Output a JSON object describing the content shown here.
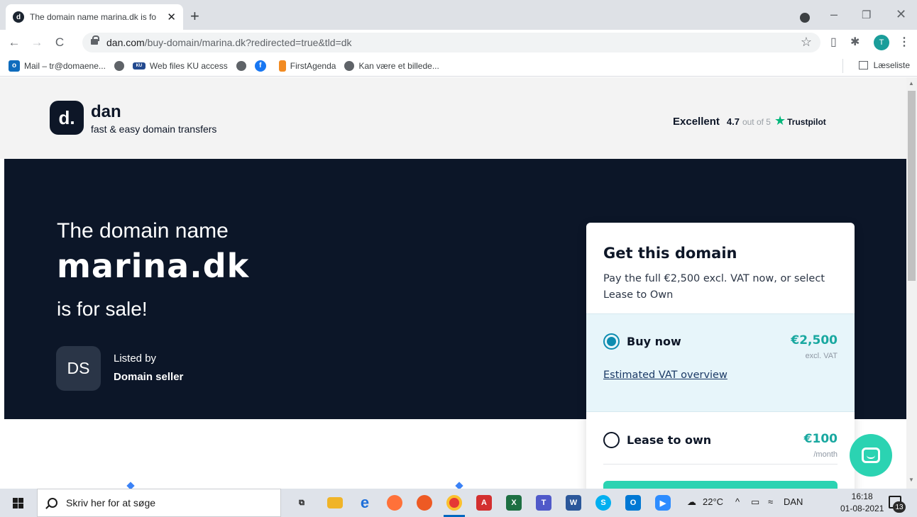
{
  "browser": {
    "tab_title": "The domain name marina.dk is fo",
    "url_host": "dan.com",
    "url_path": "/buy-domain/marina.dk?redirected=true&tld=dk",
    "new_tab": "+",
    "profile_initial": "T",
    "bookmarks": [
      {
        "label": "Mail – tr@domaene...",
        "icon": "outlook-icon"
      },
      {
        "label": "",
        "icon": "globe-icon"
      },
      {
        "label": "Web files KU access",
        "icon": "webfiles-icon"
      },
      {
        "label": "",
        "icon": "globe-icon"
      },
      {
        "label": "",
        "icon": "facebook-icon"
      },
      {
        "label": "FirstAgenda",
        "icon": "firstagenda-icon"
      },
      {
        "label": "Kan være et billede...",
        "icon": "globe-icon"
      }
    ],
    "reading_list": "Læseliste"
  },
  "header": {
    "brand": "dan",
    "tagline": "fast & easy domain transfers",
    "trust_word": "Excellent",
    "trust_rating": "4.7",
    "trust_outof": "out of 5",
    "trust_brand": "Trustpilot"
  },
  "hero": {
    "line1": "The domain name",
    "domain": "marina.dk",
    "line3": "is for sale!",
    "seller_initials": "DS",
    "listed_by": "Listed by",
    "seller_name": "Domain seller"
  },
  "card": {
    "title": "Get this domain",
    "subtitle": "Pay the full €2,500 excl. VAT now, or select Lease to Own",
    "buy": {
      "label": "Buy now",
      "price": "€2,500",
      "note": "excl. VAT",
      "link": "Estimated VAT overview",
      "selected": true
    },
    "lease": {
      "label": "Lease to own",
      "price": "€100",
      "note": "/month",
      "selected": false
    }
  },
  "taskbar": {
    "search_placeholder": "Skriv her for at søge",
    "weather": "22°C",
    "language": "DAN",
    "time": "16:18",
    "date": "01-08-2021",
    "notifications": "13"
  },
  "colors": {
    "hero_bg": "#0c1628",
    "accent_teal": "#2bd3b2",
    "price_teal": "#19a8a0",
    "radio_blue": "#0d8cb0",
    "trustpilot_green": "#00b67a"
  }
}
